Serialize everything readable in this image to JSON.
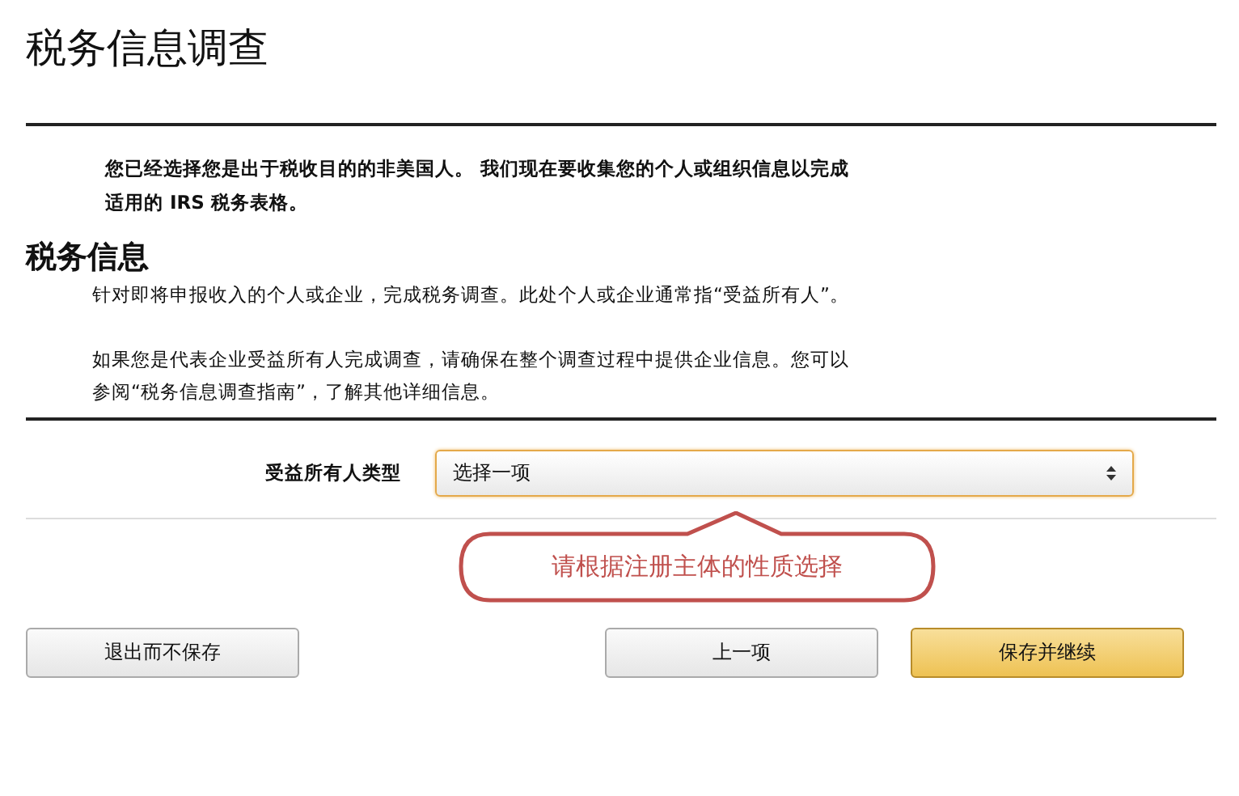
{
  "page_title": "税务信息调查",
  "intro": "您已经选择您是出于税收目的的非美国人。 我们现在要收集您的个人或组织信息以完成适用的 IRS 税务表格。",
  "section": {
    "heading": "税务信息",
    "paragraphs": [
      "针对即将申报收入的个人或企业，完成税务调查。此处个人或企业通常指“受益所有人”。",
      "如果您是代表企业受益所有人完成调查，请确保在整个调查过程中提供企业信息。您可以参阅“税务信息调查指南”，了解其他详细信息。"
    ]
  },
  "field": {
    "label": "受益所有人类型",
    "value": "选择一项",
    "focused": true
  },
  "callout": "请根据注册主体的性质选择",
  "buttons": [
    {
      "label": "退出而不保存",
      "kind": "plain"
    },
    {
      "label": "上一项",
      "kind": "plain"
    },
    {
      "label": "保存并继续",
      "kind": "primary"
    }
  ]
}
